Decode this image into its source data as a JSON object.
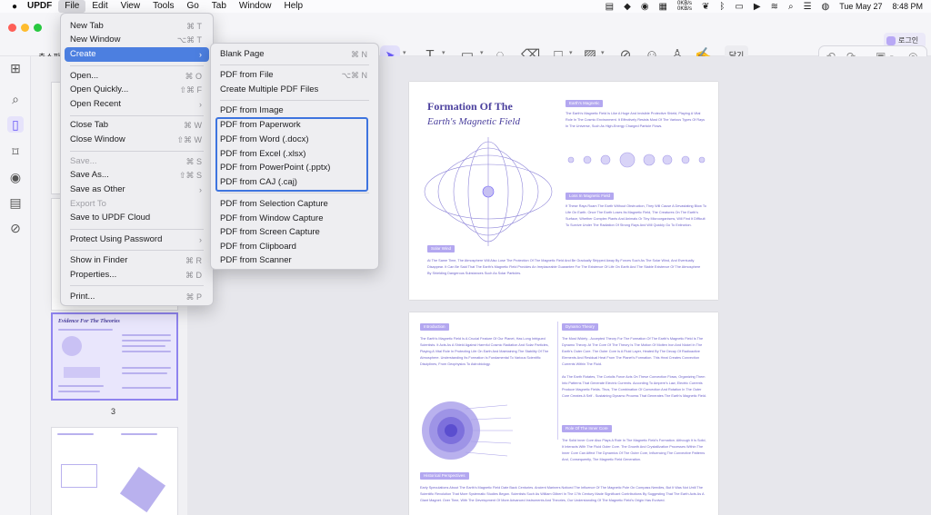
{
  "menubar": {
    "app_name": "UPDF",
    "items": [
      "File",
      "Edit",
      "View",
      "Tools",
      "Go",
      "Tab",
      "Window",
      "Help"
    ],
    "net_up": "0KB/s",
    "net_down": "0KB/s",
    "date": "Tue May 27",
    "time": "8:48 PM"
  },
  "toolbar": {
    "zoom_label": "축소판",
    "close_label": "닫기",
    "login_label": "로그인"
  },
  "file_menu": {
    "items": [
      {
        "label": "New Tab",
        "shortcut": "⌘ T"
      },
      {
        "label": "New Window",
        "shortcut": "⌥⌘ T"
      },
      {
        "label": "Create",
        "shortcut": "›"
      },
      {
        "label": "Open...",
        "shortcut": "⌘ O"
      },
      {
        "label": "Open Quickly...",
        "shortcut": "⇧⌘ F"
      },
      {
        "label": "Open Recent",
        "shortcut": "›"
      },
      {
        "label": "Close Tab",
        "shortcut": "⌘ W"
      },
      {
        "label": "Close Window",
        "shortcut": "⇧⌘ W"
      },
      {
        "label": "Save...",
        "shortcut": "⌘ S"
      },
      {
        "label": "Save As...",
        "shortcut": "⇧⌘ S"
      },
      {
        "label": "Save as Other",
        "shortcut": "›"
      },
      {
        "label": "Export To",
        "shortcut": ""
      },
      {
        "label": "Save to UPDF Cloud",
        "shortcut": ""
      },
      {
        "label": "Protect Using Password",
        "shortcut": "›"
      },
      {
        "label": "Show in Finder",
        "shortcut": "⌘ R"
      },
      {
        "label": "Properties...",
        "shortcut": "⌘ D"
      },
      {
        "label": "Print...",
        "shortcut": "⌘ P"
      }
    ]
  },
  "create_menu": {
    "items": [
      {
        "label": "Blank Page",
        "shortcut": "⌘ N"
      },
      {
        "label": "PDF from File",
        "shortcut": "⌥⌘ N"
      },
      {
        "label": "Create Multiple PDF Files",
        "shortcut": ""
      },
      {
        "label": "PDF from Image",
        "shortcut": ""
      },
      {
        "label": "PDF from Paperwork",
        "shortcut": ""
      },
      {
        "label": "PDF from Word (.docx)",
        "shortcut": ""
      },
      {
        "label": "PDF from Excel (.xlsx)",
        "shortcut": ""
      },
      {
        "label": "PDF from PowerPoint (.pptx)",
        "shortcut": ""
      },
      {
        "label": "PDF from CAJ (.caj)",
        "shortcut": ""
      },
      {
        "label": "PDF from Selection Capture",
        "shortcut": ""
      },
      {
        "label": "PDF from Window Capture",
        "shortcut": ""
      },
      {
        "label": "PDF from Screen Capture",
        "shortcut": ""
      },
      {
        "label": "PDF from Clipboard",
        "shortcut": ""
      },
      {
        "label": "PDF from Scanner",
        "shortcut": ""
      }
    ]
  },
  "thumbnails": {
    "page3_label": "3",
    "page3_title": "Evidence For The Theories"
  },
  "document": {
    "page1": {
      "title_line1": "Formation Of The",
      "title_line2": "Earth's Magnetic Field",
      "badge_earths_magnetic": "Earth's Magnetic",
      "badge_loss": "Loss In Magnetic Field",
      "badge_solar": "Solar Wind",
      "para1": "The Earth's Magnetic Field Is Like A Huge And Invisible Protective Shield, Playing A Vital Role In The Cosmic Environment. It Effectively Resists Most Of The Various Types Of Rays In The Universe, Such As High-Energy Charged Particle Flows.",
      "para2": "If These Rays Roam The Earth Without Obstruction, They Will Cause A Devastating Blow To Life On Earth. Once The Earth Loses Its Magnetic Field, The Creatures On The Earth's Surface, Whether Complex Plants And Animals Or Tiny Microorganisms, Will Find It Difficult To Survive Under The Radiation Of Strong Rays And Will Quickly Go To Extinction.",
      "para3": "At The Same Time, The Atmosphere Will Also Lose The Protection Of The Magnetic Field And Be Gradually Stripped Away By Forces Such As The Solar Wind, And Eventually Disappear. It Can Be Said That The Earth's Magnetic Field Provides An Irreplaceable Guarantee For The Existence Of Life On Earth And The Stable Existence Of The Atmosphere By Shielding Dangerous Substances Such As Solar Particles."
    },
    "page2": {
      "badge_intro": "Introduction",
      "badge_dynamo": "Dynamo Theory",
      "badge_inner": "Role Of The Inner Core",
      "badge_hist": "Historical Perspectives",
      "para_intro": "The Earth's Magnetic Field Is A Crucial Feature Of Our Planet, Has Long Intrigued Scientists. It Acts As A Shield Against Harmful Cosmic Radiation And Solar Particles, Playing A Vital Role In Protecting Life On Earth And Maintaining The Stability Of The Atmosphere. Understanding Its Formation Is Fundamental To Various Scientific Disciplines, From Geophysics To Astrobiology.",
      "para_dynamo": "The Most Widely - Accepted Theory For The Formation Of The Earth's Magnetic Field Is The Dynamo Theory. At The Core Of The Theory Is The Motion Of Molten Iron And Nickel In The Earth's Outer Core. The Outer Core Is A Fluid Layer, Heated By The Decay Of Radioactive Elements And Residual Heat From The Planet's Formation. This Heat Creates Convection Currents Within The Fluid.",
      "para_dynamo2": "As The Earth Rotates, The Coriolis Force Acts On These Convection Flows, Organizing Them Into Patterns That Generate Electric Currents. According To Ampere's Law, Electric Currents Produce Magnetic Fields. Thus, The Combination Of Convection And Rotation In The Outer Core Creates A Self - Sustaining Dynamo Process That Generates The Earth's Magnetic Field.",
      "para_inner": "The Solid Inner Core Also Plays A Role In The Magnetic Field's Formation. Although It Is Solid, It Interacts With The Fluid Outer Core. The Growth And Crystallization Processes Within The Inner Core Can Affect The Dynamics Of The Outer Core, Influencing The Convective Patterns And, Consequently, The Magnetic Field Generation.",
      "para_hist": "Early Speculations About The Earth's Magnetic Field Date Back Centuries. Ancient Mariners Noticed The Influence Of The Magnetic Pole On Compass Needles, But It Was Not Until The Scientific Revolution That More Systematic Studies Began. Scientists Such As William Gilbert In The 17th Century Made Significant Contributions By Suggesting That The Earth Acts As A Giant Magnet. Over Time, With The Development Of More Advanced Instruments And Theories, Our Understanding Of The Magnetic Field's Origin Has Evolved."
    }
  },
  "colors": {
    "accent": "#6b5cf6",
    "menu_highlight": "#4c7fe0",
    "outline": "#3e74df",
    "doc_text": "#4a3f9d"
  }
}
